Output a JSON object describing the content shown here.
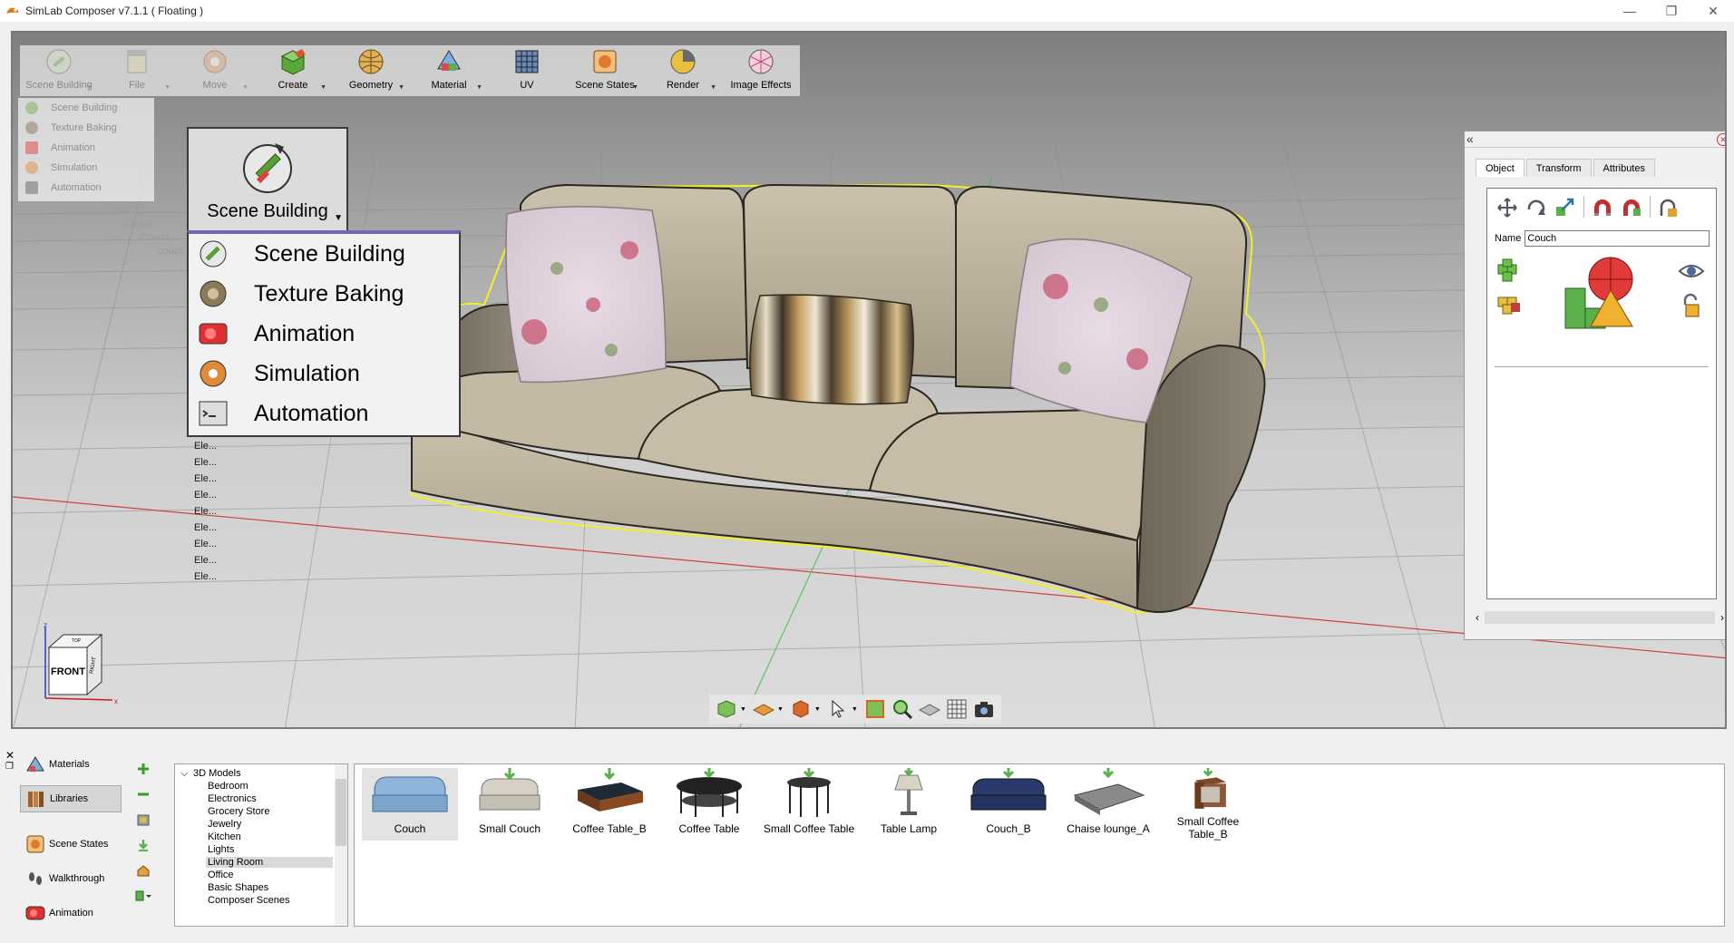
{
  "window": {
    "title": "SimLab Composer v7.1.1 ( Floating )",
    "minimize_glyph": "—",
    "restore_glyph": "❐",
    "close_glyph": "✕"
  },
  "toolbar": {
    "items": [
      {
        "label": "Scene Building",
        "icon": "scene-building-icon"
      },
      {
        "label": "File",
        "icon": "file-icon"
      },
      {
        "label": "Move",
        "icon": "move-icon"
      },
      {
        "label": "Create",
        "icon": "create-icon"
      },
      {
        "label": "Geometry",
        "icon": "geometry-icon"
      },
      {
        "label": "Material",
        "icon": "material-icon"
      },
      {
        "label": "UV",
        "icon": "uv-icon"
      },
      {
        "label": "Scene States",
        "icon": "scene-states-icon"
      },
      {
        "label": "Render",
        "icon": "render-icon"
      },
      {
        "label": "Image Effects",
        "icon": "image-effects-icon"
      }
    ]
  },
  "mode_menu": {
    "button_label": "Scene Building",
    "items": [
      "Scene Building",
      "Texture Baking",
      "Animation",
      "Simulation",
      "Automation"
    ]
  },
  "scene_tree": {
    "faint_items": [
      "Couch1",
      "Couch",
      "Couch",
      "couch"
    ],
    "element_items": [
      "Ele...",
      "Ele...",
      "Ele...",
      "Ele...",
      "Ele...",
      "Ele...",
      "Ele...",
      "Ele...",
      "Ele..."
    ]
  },
  "properties": {
    "tabs": [
      "Object",
      "Transform",
      "Attributes"
    ],
    "active_tab": "Object",
    "name_label": "Name",
    "name_value": "Couch"
  },
  "view_cube": {
    "front": "FRONT",
    "right": "RIGHT",
    "top": "TOP",
    "axis_z": "z",
    "axis_x": "x"
  },
  "left_nav": {
    "items": [
      "Materials",
      "Libraries",
      "Scene States",
      "Walkthrough",
      "Animation"
    ],
    "active": "Libraries"
  },
  "categories": {
    "root": "3D Models",
    "items": [
      "Bedroom",
      "Electronics",
      "Grocery Store",
      "Jewelry",
      "Kitchen",
      "Lights",
      "Living Room",
      "Office",
      "Basic Shapes",
      "Composer Scenes"
    ],
    "selected": "Living Room"
  },
  "library": {
    "items": [
      "Couch",
      "Small Couch",
      "Coffee Table_B",
      "Coffee Table",
      "Small Coffee Table",
      "Table Lamp",
      "Couch_B",
      "Chaise lounge_A",
      "Small Coffee Table_B"
    ],
    "selected": "Couch"
  },
  "colors": {
    "selection_outline": "#f2ee2a",
    "couch_fabric": "#bdb39f",
    "grid_line": "#8d8d8d",
    "menu_accent": "#6b6bb8"
  }
}
